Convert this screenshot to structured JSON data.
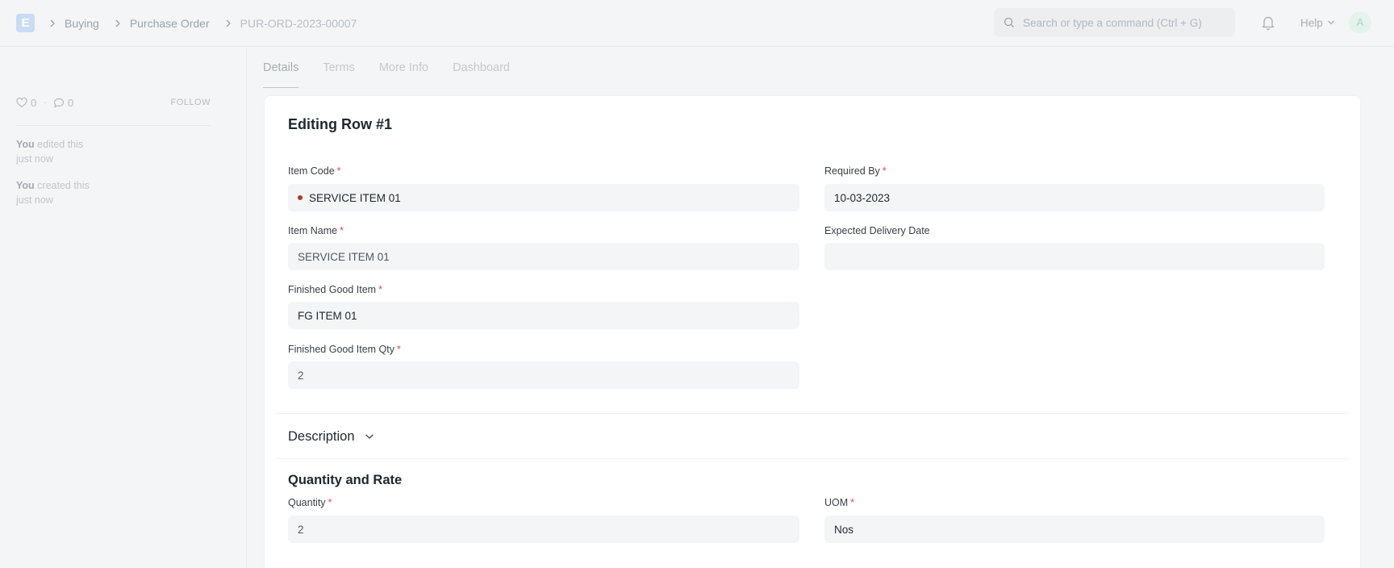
{
  "navbar": {
    "logo_letter": "E",
    "breadcrumbs": [
      "Buying",
      "Purchase Order",
      "PUR-ORD-2023-00007"
    ],
    "search_placeholder": "Search or type a command (Ctrl + G)",
    "help_label": "Help",
    "avatar_letter": "A"
  },
  "sidebar": {
    "likes": "0",
    "comments": "0",
    "follow_label": "FOLLOW",
    "activity": [
      {
        "actor": "You",
        "action": "edited this",
        "time": "just now"
      },
      {
        "actor": "You",
        "action": "created this",
        "time": "just now"
      }
    ]
  },
  "tabs": [
    "Details",
    "Terms",
    "More Info",
    "Dashboard"
  ],
  "form": {
    "title": "Editing Row #1",
    "item_code": {
      "label": "Item Code",
      "value": "SERVICE ITEM 01"
    },
    "required_by": {
      "label": "Required By",
      "value": "10-03-2023"
    },
    "item_name": {
      "label": "Item Name",
      "value": "SERVICE ITEM 01"
    },
    "expected_delivery": {
      "label": "Expected Delivery Date",
      "value": ""
    },
    "fg_item": {
      "label": "Finished Good Item",
      "value": "FG ITEM 01"
    },
    "fg_qty": {
      "label": "Finished Good Item Qty",
      "value": "2"
    },
    "description_section": "Description",
    "qty_rate_section": "Quantity and Rate",
    "quantity": {
      "label": "Quantity",
      "value": "2"
    },
    "uom": {
      "label": "UOM",
      "value": "Nos"
    },
    "required_mark": "*"
  },
  "colors": {
    "accent_logo": "#c9dbf5",
    "required": "#e24c4c",
    "status_dot": "#a83b2d"
  }
}
